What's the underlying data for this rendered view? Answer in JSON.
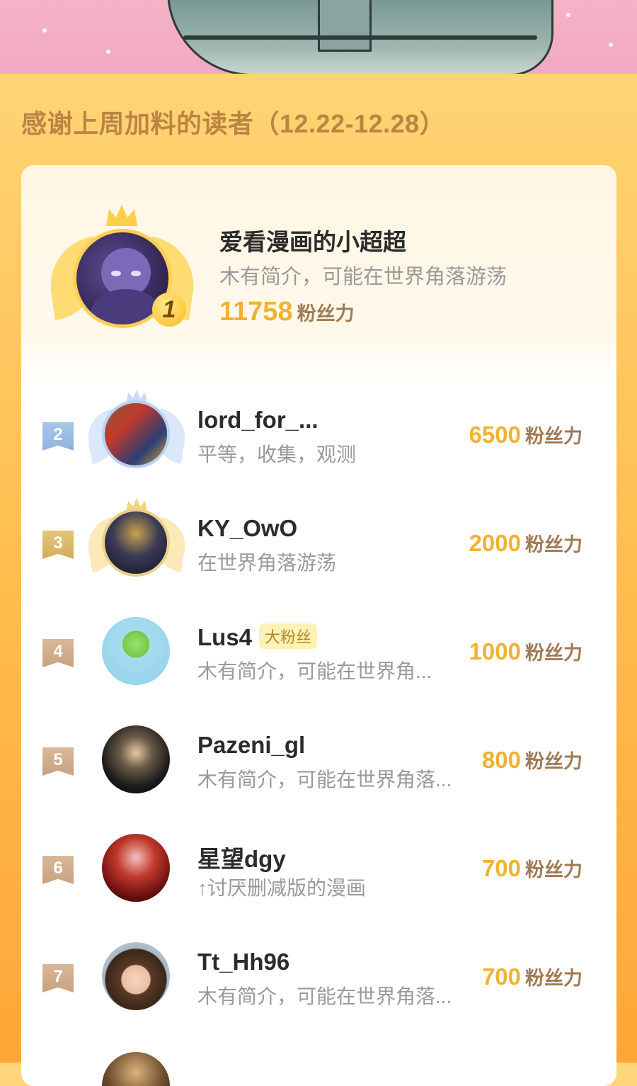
{
  "header": {
    "title": "感谢上周加料的读者（12.22-12.28）"
  },
  "winner": {
    "rank": "1",
    "name": "爱看漫画的小超超",
    "bio": "木有简介，可能在世界角落游荡",
    "power": "11758",
    "unit": "粉丝力"
  },
  "rows": [
    {
      "rank": "2",
      "name": "lord_for_...",
      "bio": "平等，收集，观测",
      "power": "6500",
      "unit": "粉丝力"
    },
    {
      "rank": "3",
      "name": "KY_OwO",
      "bio": "在世界角落游荡",
      "power": "2000",
      "unit": "粉丝力"
    },
    {
      "rank": "4",
      "name": "Lus4",
      "tag": "大粉丝",
      "bio": "木有简介，可能在世界角...",
      "power": "1000",
      "unit": "粉丝力"
    },
    {
      "rank": "5",
      "name": "Pazeni_gl",
      "bio": "木有简介，可能在世界角落...",
      "power": "800",
      "unit": "粉丝力"
    },
    {
      "rank": "6",
      "name": "星望dgy",
      "bio": "↑讨厌删减版的漫画",
      "power": "700",
      "unit": "粉丝力"
    },
    {
      "rank": "7",
      "name": "Tt_Hh96",
      "bio": "木有简介，可能在世界角落...",
      "power": "700",
      "unit": "粉丝力"
    }
  ],
  "colors": {
    "accent": "#f2b230",
    "title": "#b98545",
    "unit": "#a07a55",
    "bio": "#9a9a9a"
  }
}
